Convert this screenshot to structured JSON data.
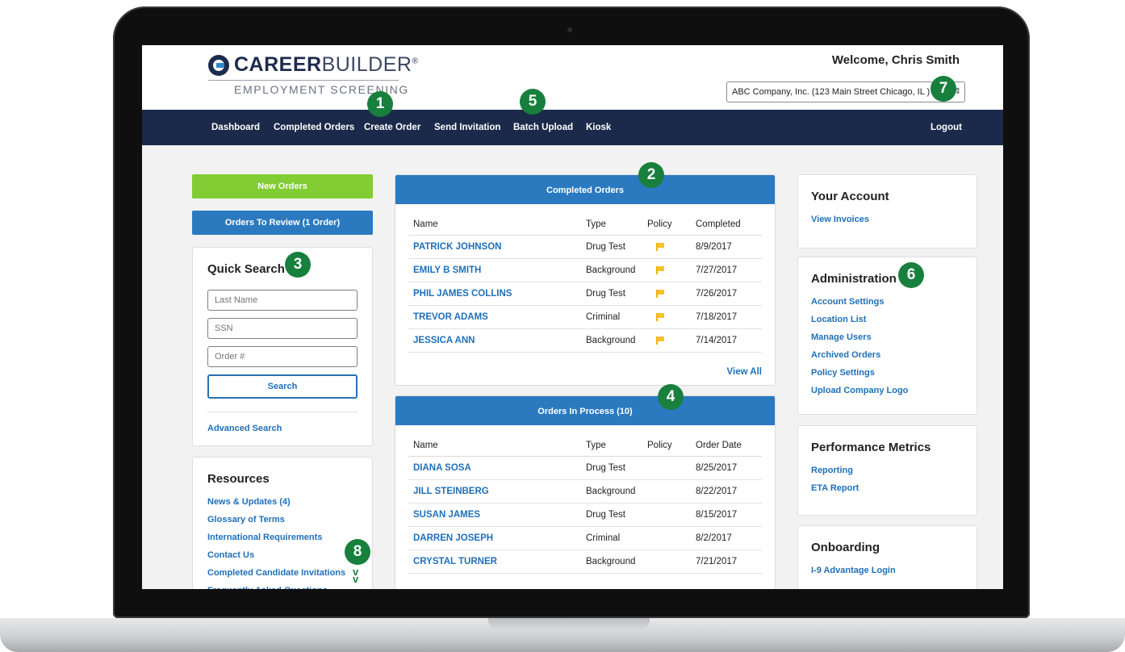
{
  "brand": {
    "name_bold": "CAREER",
    "name_light": "BUILDER",
    "mark": "®",
    "subtitle": "EMPLOYMENT SCREENING"
  },
  "header": {
    "welcome": "Welcome, Chris Smith",
    "company_selected": "ABC Company, Inc. (123 Main Street Chicago, IL )"
  },
  "nav": {
    "items": [
      "Dashboard",
      "Completed Orders",
      "Create Order",
      "Send Invitation",
      "Batch Upload",
      "Kiosk"
    ],
    "logout": "Logout"
  },
  "left": {
    "new_orders": "New Orders",
    "orders_to_review": "Orders To Review   (1 Order)",
    "quick_search": {
      "title": "Quick Search",
      "last_name_placeholder": "Last Name",
      "ssn_placeholder": "SSN",
      "order_placeholder": "Order #",
      "search_button": "Search",
      "advanced": "Advanced Search"
    },
    "resources": {
      "title": "Resources",
      "links": [
        "News & Updates (4)",
        "Glossary of Terms",
        "International Requirements",
        "Contact Us",
        "Completed Candidate Invitations",
        "Frequently Asked Questions"
      ]
    }
  },
  "completed_orders": {
    "title": "Completed Orders",
    "columns": [
      "Name",
      "Type",
      "Policy",
      "Completed"
    ],
    "rows": [
      {
        "name": "PATRICK JOHNSON",
        "type": "Drug Test",
        "date": "8/9/2017"
      },
      {
        "name": "EMILY B SMITH",
        "type": "Background",
        "date": "7/27/2017"
      },
      {
        "name": "PHIL JAMES COLLINS",
        "type": "Drug Test",
        "date": "7/26/2017"
      },
      {
        "name": "TREVOR ADAMS",
        "type": "Criminal",
        "date": "7/18/2017"
      },
      {
        "name": "JESSICA ANN",
        "type": "Background",
        "date": "7/14/2017"
      }
    ],
    "view_all": "View All"
  },
  "orders_in_process": {
    "title": "Orders In Process (10)",
    "columns": [
      "Name",
      "Type",
      "Policy",
      "Order Date"
    ],
    "rows": [
      {
        "name": "DIANA SOSA",
        "type": "Drug Test",
        "date": "8/25/2017"
      },
      {
        "name": "JILL STEINBERG",
        "type": "Background",
        "date": "8/22/2017"
      },
      {
        "name": "SUSAN JAMES",
        "type": "Drug Test",
        "date": "8/15/2017"
      },
      {
        "name": "DARREN JOSEPH",
        "type": "Criminal",
        "date": "8/2/2017"
      },
      {
        "name": "CRYSTAL TURNER",
        "type": "Background",
        "date": "7/21/2017"
      }
    ]
  },
  "right": {
    "your_account": {
      "title": "Your Account",
      "links": [
        "View Invoices"
      ]
    },
    "administration": {
      "title": "Administration",
      "links": [
        "Account Settings",
        "Location List",
        "Manage Users",
        "Archived Orders",
        "Policy Settings",
        "Upload Company Logo"
      ]
    },
    "performance": {
      "title": "Performance Metrics",
      "links": [
        "Reporting",
        "ETA Report"
      ]
    },
    "onboarding": {
      "title": "Onboarding",
      "links": [
        "I-9 Advantage Login"
      ]
    }
  },
  "callouts": [
    "1",
    "2",
    "3",
    "4",
    "5",
    "6",
    "7",
    "8"
  ],
  "colors": {
    "nav_bg": "#1b2a4a",
    "accent_blue": "#2b7ac0",
    "green_button": "#82cd33",
    "link": "#2070b8",
    "policy_flag": "#f7c22b",
    "callout": "#17803c"
  },
  "icons": {
    "logo": "careerbuilder-logo-icon",
    "policy": "flag-icon",
    "select": "chevron-updown-icon",
    "scroll_hint": "double-chevron-down-icon"
  }
}
